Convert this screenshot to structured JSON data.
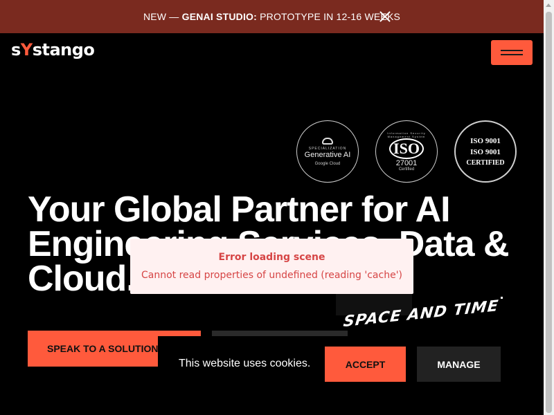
{
  "announcement": {
    "prefix": "NEW — ",
    "highlight": "GENAI STUDIO:",
    "text": " PROTOTYPE IN 12-16 WEEKS"
  },
  "logo": {
    "part1": "s",
    "part2": "Y",
    "part3": "stango"
  },
  "badges": [
    {
      "top": "SPECIALIZATION",
      "main": "Generative AI",
      "bottom": "Google Cloud"
    },
    {
      "top": "Information Security Management System",
      "main": "ISO",
      "sub": "27001",
      "bottom": "Certified"
    },
    {
      "top": "ISO 9001",
      "main": "ISO 9001",
      "bottom": "CERTIFIED"
    }
  ],
  "hero": {
    "title": "Your Global Partner for AI Engineering Services, Data & Cloud."
  },
  "buttons": {
    "primary": "SPEAK TO A SOLUTIONS",
    "space_time": "SPACE AND TIME"
  },
  "error": {
    "title": "Error loading scene",
    "message": "Cannot read properties of undefined (reading 'cache')"
  },
  "cookie": {
    "message": "This website uses cookies.",
    "accept": "ACCEPT",
    "manage": "MANAGE"
  },
  "colors": {
    "accent": "#ff5a3c",
    "announcement_bg": "#7a2a1f",
    "error_text": "#d64545"
  }
}
